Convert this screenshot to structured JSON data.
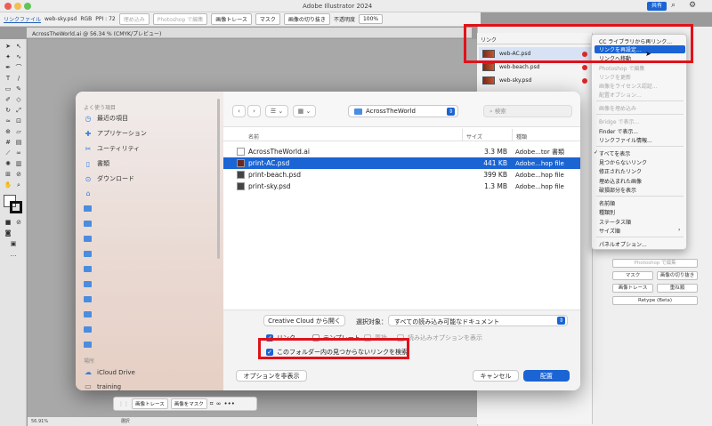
{
  "window": {
    "title": "Adobe Illustrator 2024",
    "share_label": "共有"
  },
  "control_bar": {
    "items": [
      "リンクファイル",
      "web-sky.psd",
      "RGB",
      "PPI : 72"
    ],
    "buttons": [
      "埋め込み",
      "Photoshop で編集",
      "画像トレース",
      "マスク",
      "画像の切り抜き"
    ],
    "opacity_label": "不透明度",
    "opacity_value": "100%"
  },
  "document_tab": {
    "label": "AcrossTheWorld.ai @ 56.34 % (CMYK/プレビュー)"
  },
  "status": {
    "zoom": "56.91%",
    "tool": "選択"
  },
  "links_panel": {
    "tab_label": "リンク",
    "items": [
      {
        "name": "web-AC.psd",
        "selected": true
      },
      {
        "name": "web-beach.psd",
        "selected": false
      },
      {
        "name": "web-sky.psd",
        "selected": false
      }
    ]
  },
  "context_menu": {
    "items": [
      {
        "label": "CC ライブラリから再リンク...",
        "enabled": true
      },
      {
        "label": "リンクを再設定...",
        "enabled": true,
        "highlighted": true
      },
      {
        "label": "リンクへ移動",
        "enabled": true
      },
      {
        "label": "Photoshop で編集",
        "enabled": false
      },
      {
        "label": "リンクを更新",
        "enabled": false
      },
      {
        "label": "画像をライセンス認証...",
        "enabled": false
      },
      {
        "label": "配置オプション...",
        "enabled": false
      },
      {
        "label": "画像を埋め込み",
        "enabled": false
      },
      {
        "label": "Bridge で表示...",
        "enabled": false
      },
      {
        "label": "Finder で表示...",
        "enabled": true
      },
      {
        "label": "リンクファイル情報...",
        "enabled": true
      },
      {
        "label": "すべてを表示",
        "enabled": true,
        "checked": true
      },
      {
        "label": "見つからないリンク",
        "enabled": true
      },
      {
        "label": "修正されたリンク",
        "enabled": true
      },
      {
        "label": "埋め込まれた画像",
        "enabled": true
      },
      {
        "label": "破損部分を表示",
        "enabled": true
      },
      {
        "label": "名前順",
        "enabled": true
      },
      {
        "label": "種類別",
        "enabled": true
      },
      {
        "label": "ステータス順",
        "enabled": true
      },
      {
        "label": "サイズ順",
        "enabled": true
      },
      {
        "label": "パネルオプション...",
        "enabled": true
      }
    ]
  },
  "properties_panel": {
    "buttons": [
      "Photoshop で編集",
      "マスク",
      "画像の切り抜き",
      "画像トレース",
      "重ね順",
      "Retype (Beta)"
    ]
  },
  "dialog": {
    "sidebar": {
      "favorites_heading": "よく使う項目",
      "favorites": [
        {
          "label": "最近の項目",
          "icon": "clock-icon"
        },
        {
          "label": "アプリケーション",
          "icon": "apps-icon"
        },
        {
          "label": "ユーティリティ",
          "icon": "tools-icon"
        },
        {
          "label": "書類",
          "icon": "document-icon"
        },
        {
          "label": "ダウンロード",
          "icon": "download-icon"
        }
      ],
      "locations_heading": "場所",
      "locations": [
        {
          "label": "iCloud Drive",
          "icon": "cloud-icon"
        },
        {
          "label": "training",
          "icon": "drive-icon"
        }
      ]
    },
    "toolbar": {
      "back": "‹",
      "forward": "›",
      "path_folder": "AcrossTheWorld",
      "search_placeholder": "検索"
    },
    "columns": {
      "name": "名前",
      "size": "サイズ",
      "kind": "種類"
    },
    "files": [
      {
        "name": "AcrossTheWorld.ai",
        "size": "3.3 MB",
        "kind": "Adobe...tor 書類",
        "selected": false
      },
      {
        "name": "print-AC.psd",
        "size": "441 KB",
        "kind": "Adobe...hop file",
        "selected": true
      },
      {
        "name": "print-beach.psd",
        "size": "399 KB",
        "kind": "Adobe...hop file",
        "selected": false
      },
      {
        "name": "print-sky.psd",
        "size": "1.3 MB",
        "kind": "Adobe...hop file",
        "selected": false
      }
    ],
    "options": {
      "cc_button": "Creative Cloud から開く",
      "select_label": "選択対象：",
      "select_value": "すべての読み込み可能なドキュメント",
      "link_label": "リンク",
      "template_label": "テンプレート",
      "replace_label": "置換",
      "import_options_label": "読み込みオプションを表示",
      "search_missing_label": "このフォルダー内の見つからないリンクを検索"
    },
    "hide_options_button": "オプションを非表示",
    "cancel_button": "キャンセル",
    "place_button": "配置"
  },
  "float_bar": {
    "buttons": [
      "画像トレース",
      "画像をマスク"
    ]
  }
}
